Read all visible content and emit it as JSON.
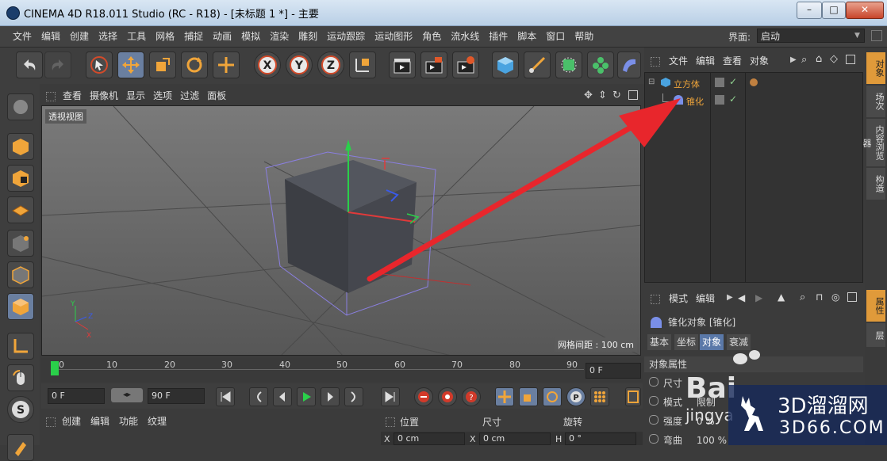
{
  "window": {
    "title": "CINEMA 4D R18.011 Studio (RC - R18) - [未标题 1 *] - 主要",
    "min": "–",
    "max": "□",
    "close": "✕"
  },
  "menu": [
    "文件",
    "编辑",
    "创建",
    "选择",
    "工具",
    "网格",
    "捕捉",
    "动画",
    "模拟",
    "渲染",
    "雕刻",
    "运动跟踪",
    "运动图形",
    "角色",
    "流水线",
    "插件",
    "脚本",
    "窗口",
    "帮助"
  ],
  "layout": {
    "label": "界面:",
    "value": "启动"
  },
  "viewport": {
    "menu": [
      "查看",
      "摄像机",
      "显示",
      "选项",
      "过滤",
      "面板"
    ],
    "label": "透视视图",
    "grid_spacing": "网格间距 : 100 cm"
  },
  "timeline": {
    "ticks": [
      "0",
      "10",
      "20",
      "30",
      "40",
      "50",
      "60",
      "70",
      "80",
      "90"
    ],
    "current_frame": "0 F"
  },
  "playback": {
    "start": "0 F",
    "end": "90 F"
  },
  "material_menu": [
    "创建",
    "编辑",
    "功能",
    "纹理"
  ],
  "coords": {
    "headers": [
      "位置",
      "尺寸",
      "旋转"
    ],
    "row": [
      "X",
      "0 cm",
      "X",
      "0 cm",
      "H",
      "0 °"
    ]
  },
  "object_manager": {
    "menu": [
      "文件",
      "编辑",
      "查看",
      "对象"
    ],
    "objects": [
      {
        "name": "立方体",
        "icon": "cube-icon"
      },
      {
        "name": "锥化",
        "icon": "taper-deformer-icon"
      }
    ]
  },
  "attributes": {
    "menu": [
      "模式",
      "编辑"
    ],
    "title": "锥化对象 [锥化]",
    "tabs": [
      "基本",
      "坐标",
      "对象",
      "衰减"
    ],
    "active_tab": "对象",
    "section": "对象属性",
    "rows": [
      "尺寸",
      "模式",
      "强度",
      "弯曲"
    ],
    "row_values": [
      "",
      "限制",
      "0 %",
      "100 %"
    ]
  },
  "right_tabs": [
    "对象",
    "场次",
    "内容浏览器",
    "构造",
    "属性",
    "层"
  ],
  "watermark": {
    "baidu": "Bai",
    "baidu2": "jingya",
    "site": "3D溜溜网",
    "url": "3D66.COM"
  },
  "colors": {
    "accent": "#e09a3a",
    "arrow": "#e8262c",
    "selection": "#5a78a8"
  }
}
